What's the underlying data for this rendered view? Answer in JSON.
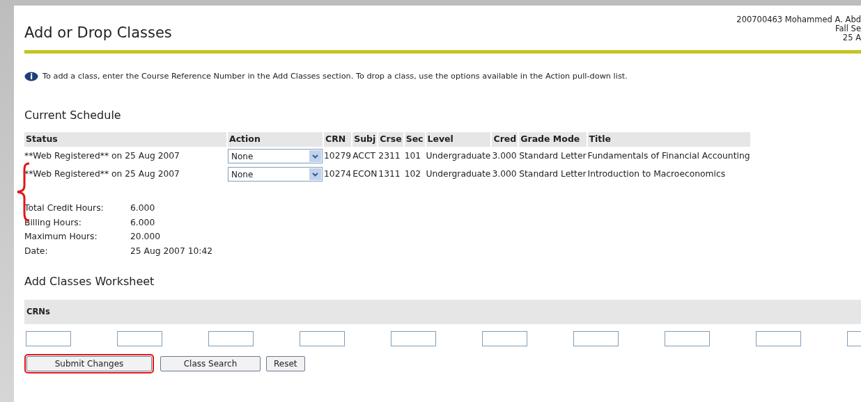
{
  "page": {
    "title": "Add or Drop Classes",
    "user_info": [
      "200700463 Mohammed A. Abd",
      "Fall Se",
      "25 A"
    ],
    "info_message": "To add a class, enter the Course Reference Number in the Add Classes section. To drop a class, use the options available in the Action pull-down list."
  },
  "current_schedule": {
    "heading": "Current Schedule",
    "columns": [
      "Status",
      "Action",
      "CRN",
      "Subj",
      "Crse",
      "Sec",
      "Level",
      "Cred",
      "Grade Mode",
      "Title"
    ],
    "rows": [
      {
        "status": "**Web Registered** on 25 Aug 2007",
        "action": "None",
        "crn": "10279",
        "subj": "ACCT",
        "crse": "2311",
        "sec": "101",
        "level": "Undergraduate",
        "cred": "3.000",
        "grade_mode": "Standard Letter",
        "title": "Fundamentals of Financial Accounting"
      },
      {
        "status": "**Web Registered** on 25 Aug 2007",
        "action": "None",
        "crn": "10274",
        "subj": "ECON",
        "crse": "1311",
        "sec": "102",
        "level": "Undergraduate",
        "cred": "3.000",
        "grade_mode": "Standard Letter",
        "title": "Introduction to Macroeconomics"
      }
    ],
    "annotated": true,
    "totals": [
      {
        "label": "Total Credit Hours:",
        "value": "6.000"
      },
      {
        "label": "Billing Hours:",
        "value": "6.000"
      },
      {
        "label": "Maximum Hours:",
        "value": "20.000"
      },
      {
        "label": "Date:",
        "value": "25 Aug 2007 10:42"
      }
    ]
  },
  "worksheet": {
    "heading": "Add Classes Worksheet",
    "column": "CRNs",
    "crn_fields": [
      {
        "kind": "text"
      },
      {
        "kind": "text"
      },
      {
        "kind": "text"
      },
      {
        "kind": "text"
      },
      {
        "kind": "text"
      },
      {
        "kind": "text"
      },
      {
        "kind": "text"
      },
      {
        "kind": "text"
      },
      {
        "kind": "text"
      },
      {
        "kind": "text"
      }
    ]
  },
  "buttons": [
    {
      "label": "Submit Changes",
      "highlighted": true
    },
    {
      "label": "Class Search",
      "highlighted": false
    },
    {
      "label": "Reset",
      "highlighted": false
    }
  ]
}
